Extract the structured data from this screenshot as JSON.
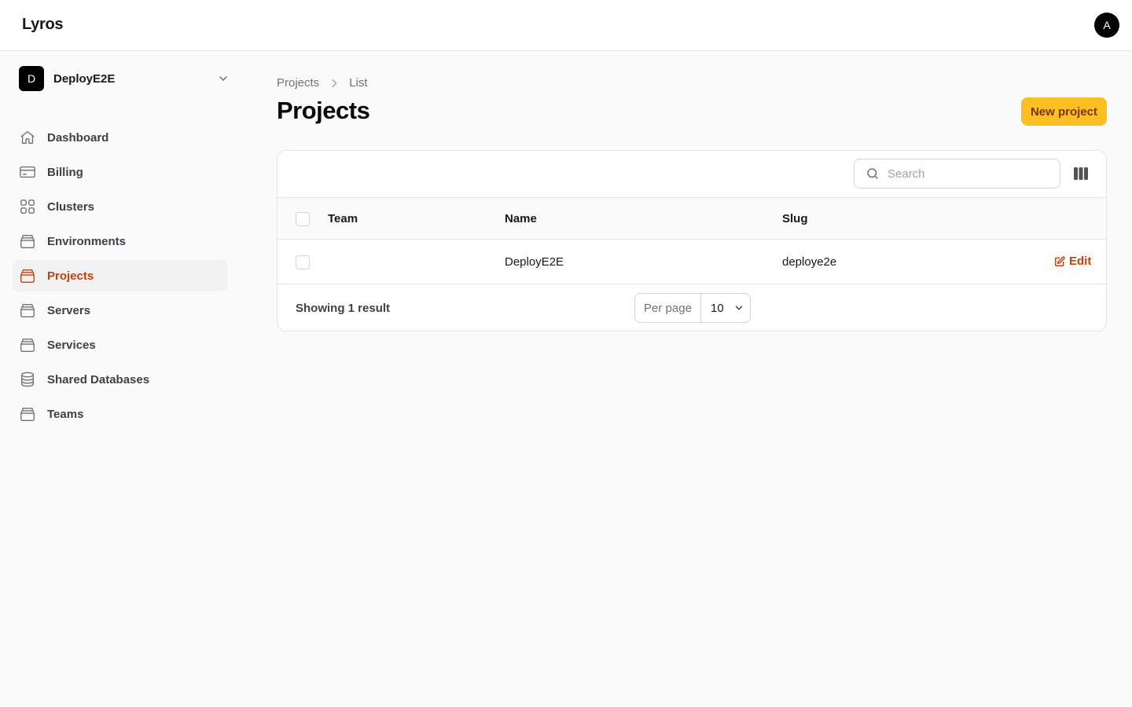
{
  "app": {
    "brand": "Lyros",
    "user_initial": "A"
  },
  "team": {
    "initial": "D",
    "name": "DeployE2E"
  },
  "sidebar": {
    "items": [
      {
        "label": "Dashboard",
        "icon": "home-icon"
      },
      {
        "label": "Billing",
        "icon": "credit-card-icon"
      },
      {
        "label": "Clusters",
        "icon": "grid-icon"
      },
      {
        "label": "Environments",
        "icon": "box-icon"
      },
      {
        "label": "Projects",
        "icon": "box-icon",
        "active": true
      },
      {
        "label": "Servers",
        "icon": "box-icon"
      },
      {
        "label": "Services",
        "icon": "box-icon"
      },
      {
        "label": "Shared Databases",
        "icon": "database-icon"
      },
      {
        "label": "Teams",
        "icon": "box-icon"
      }
    ]
  },
  "breadcrumb": [
    "Projects",
    "List"
  ],
  "page": {
    "title": "Projects",
    "new_button": "New project"
  },
  "table": {
    "search_placeholder": "Search",
    "columns": [
      "Team",
      "Name",
      "Slug"
    ],
    "rows": [
      {
        "team": "",
        "name": "DeployE2E",
        "slug": "deploye2e",
        "action": "Edit"
      }
    ],
    "footer": {
      "summary": "Showing 1 result",
      "per_page_label": "Per page",
      "per_page_value": "10"
    }
  },
  "colors": {
    "accent": "#c2410c",
    "primary_button": "#fbbf24",
    "active_nav_bg": "#f1f1f2"
  }
}
